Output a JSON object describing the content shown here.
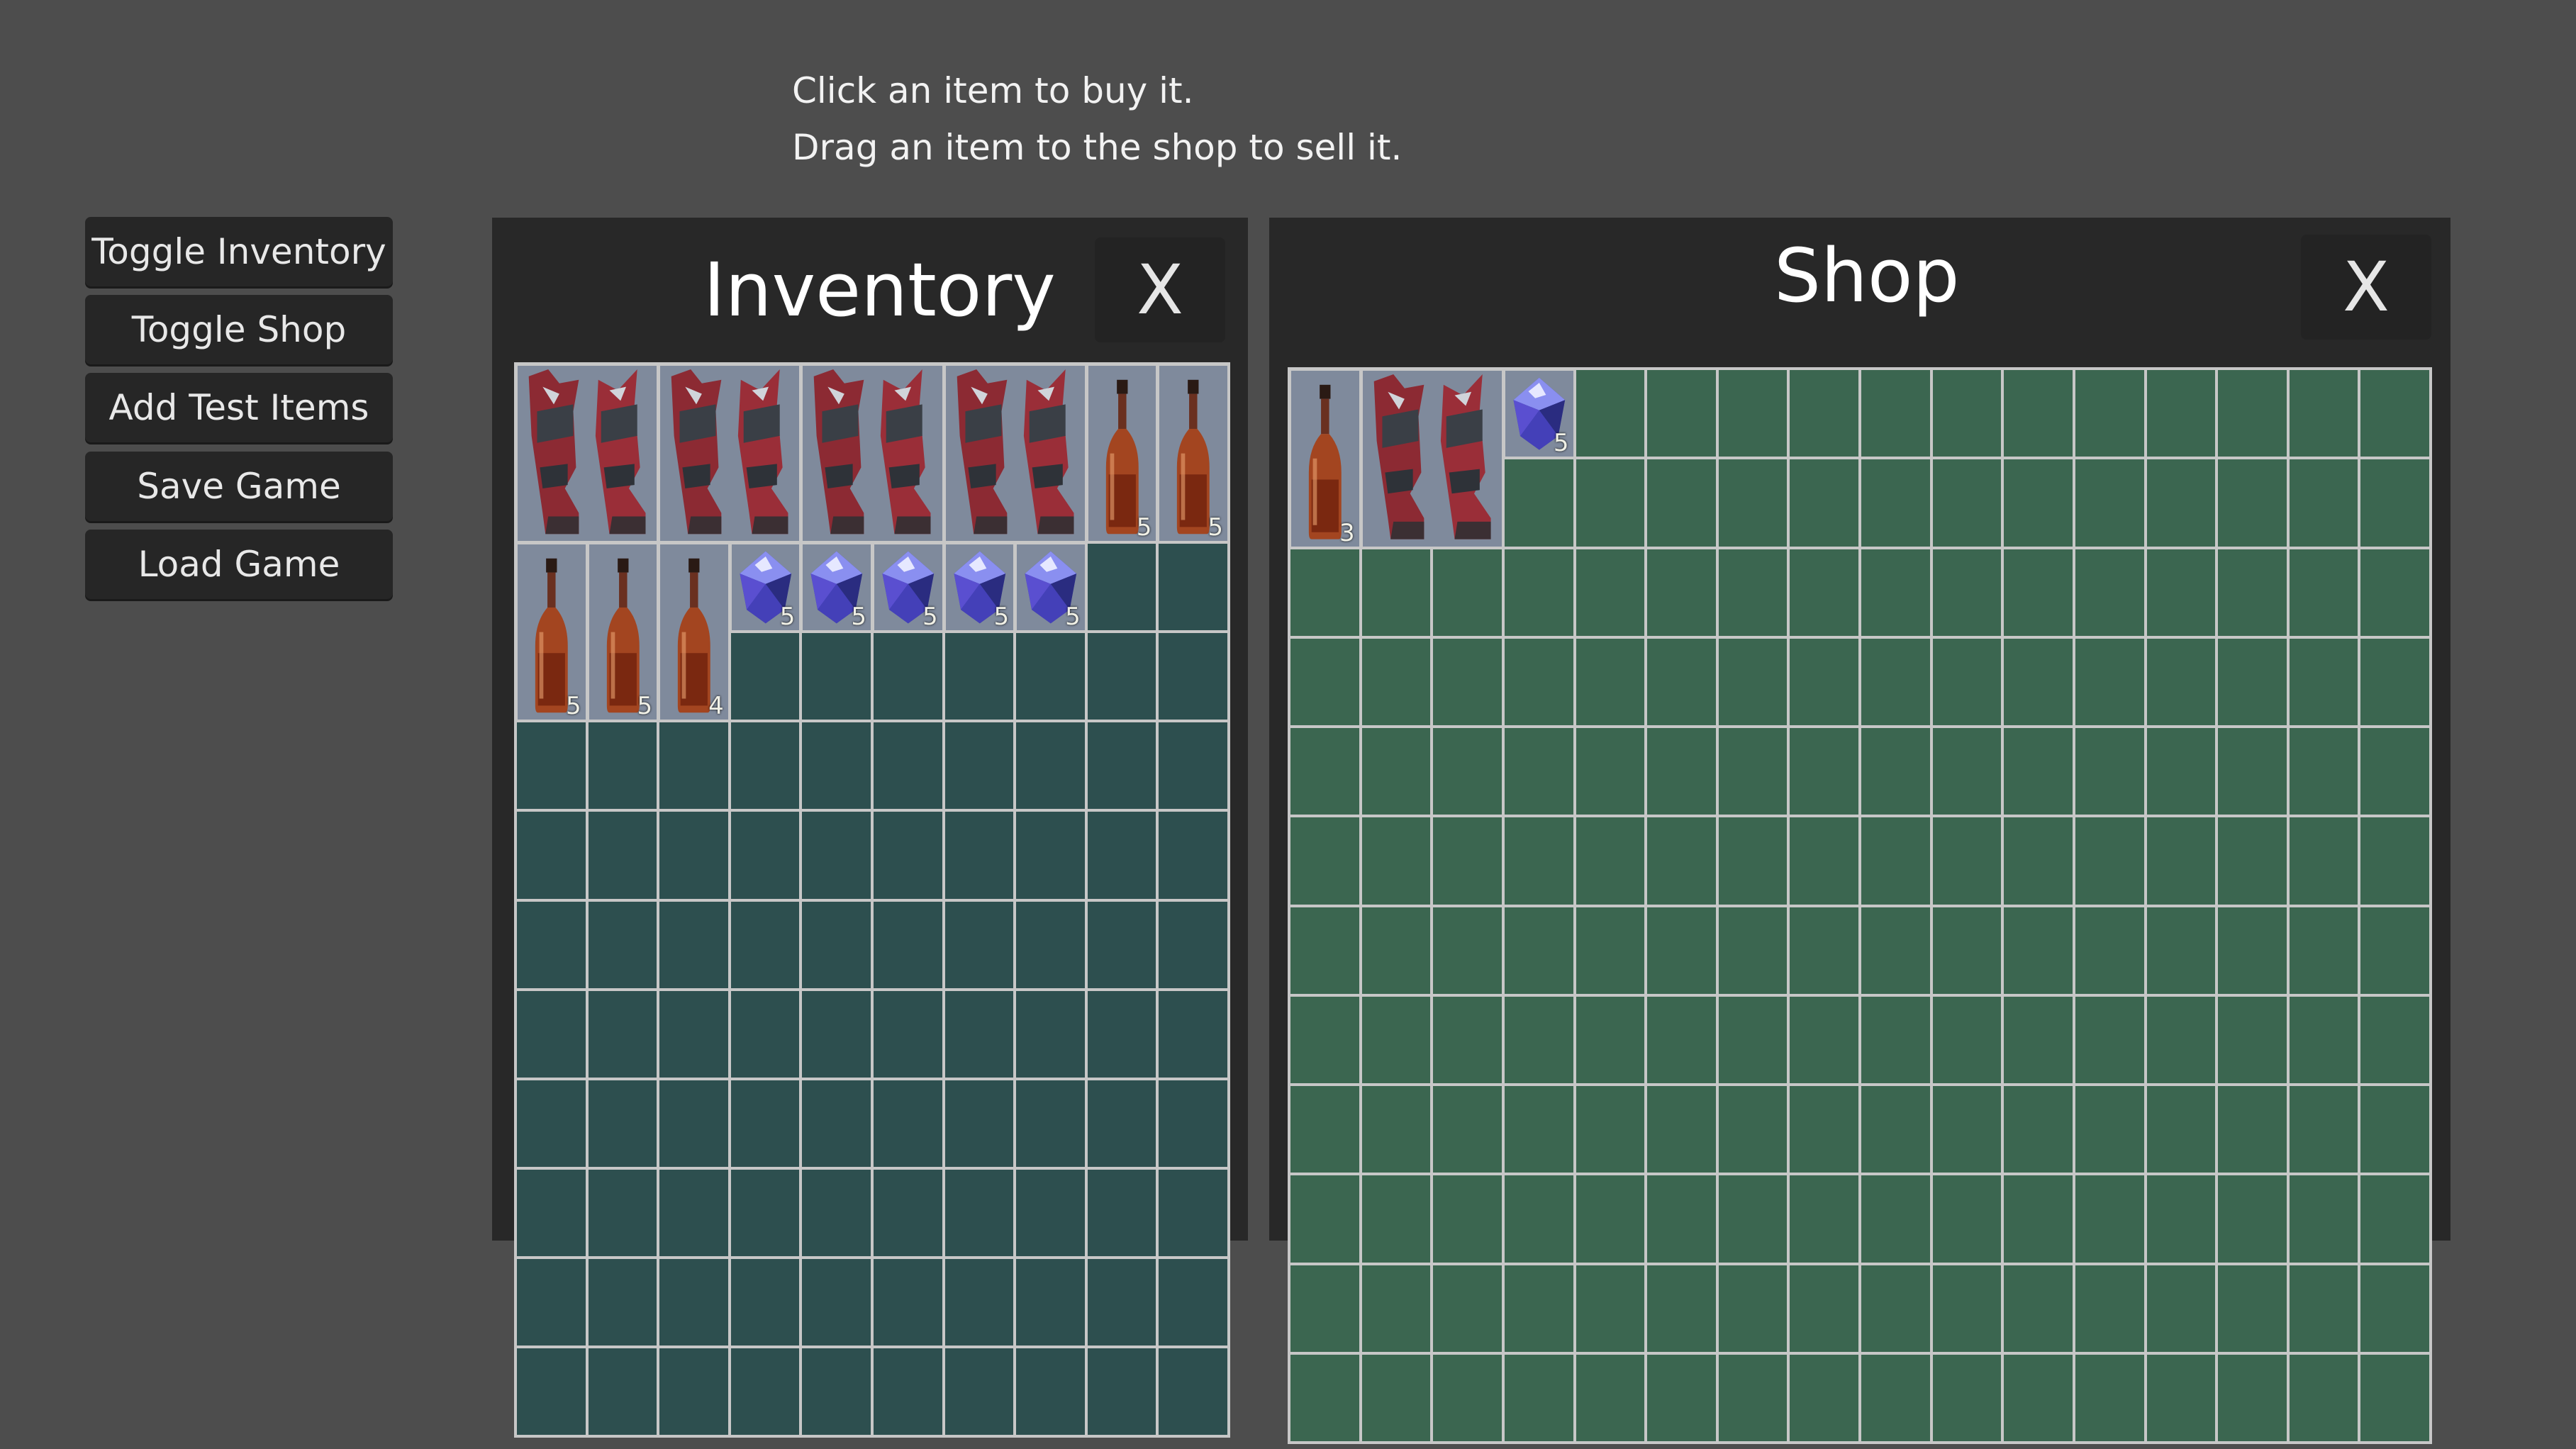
{
  "instructions": {
    "line1": "Click an item to buy it.",
    "line2": "Drag an item to the shop to sell it."
  },
  "sidebar": {
    "buttons": [
      {
        "label": "Toggle Inventory"
      },
      {
        "label": "Toggle Shop"
      },
      {
        "label": "Add Test Items"
      },
      {
        "label": "Save Game"
      },
      {
        "label": "Load Game"
      }
    ]
  },
  "inventory": {
    "title": "Inventory",
    "close_label": "X",
    "columns": 10,
    "rows": 12,
    "items": [
      {
        "type": "boots-icon",
        "col": 0,
        "row": 0,
        "w": 2,
        "h": 2,
        "qty": ""
      },
      {
        "type": "boots-icon",
        "col": 2,
        "row": 0,
        "w": 2,
        "h": 2,
        "qty": ""
      },
      {
        "type": "boots-icon",
        "col": 4,
        "row": 0,
        "w": 2,
        "h": 2,
        "qty": ""
      },
      {
        "type": "boots-icon",
        "col": 6,
        "row": 0,
        "w": 2,
        "h": 2,
        "qty": ""
      },
      {
        "type": "potion-icon",
        "col": 8,
        "row": 0,
        "w": 1,
        "h": 2,
        "qty": "5"
      },
      {
        "type": "potion-icon",
        "col": 9,
        "row": 0,
        "w": 1,
        "h": 2,
        "qty": "5"
      },
      {
        "type": "potion-icon",
        "col": 0,
        "row": 2,
        "w": 1,
        "h": 2,
        "qty": "5"
      },
      {
        "type": "potion-icon",
        "col": 1,
        "row": 2,
        "w": 1,
        "h": 2,
        "qty": "5"
      },
      {
        "type": "potion-icon",
        "col": 2,
        "row": 2,
        "w": 1,
        "h": 2,
        "qty": "4"
      },
      {
        "type": "gem-icon",
        "col": 3,
        "row": 2,
        "w": 1,
        "h": 1,
        "qty": "5"
      },
      {
        "type": "gem-icon",
        "col": 4,
        "row": 2,
        "w": 1,
        "h": 1,
        "qty": "5"
      },
      {
        "type": "gem-icon",
        "col": 5,
        "row": 2,
        "w": 1,
        "h": 1,
        "qty": "5"
      },
      {
        "type": "gem-icon",
        "col": 6,
        "row": 2,
        "w": 1,
        "h": 1,
        "qty": "5"
      },
      {
        "type": "gem-icon",
        "col": 7,
        "row": 2,
        "w": 1,
        "h": 1,
        "qty": "5"
      }
    ]
  },
  "shop": {
    "title": "Shop",
    "close_label": "X",
    "columns": 16,
    "rows": 12,
    "items": [
      {
        "type": "potion-icon",
        "col": 0,
        "row": 0,
        "w": 1,
        "h": 2,
        "qty": "3"
      },
      {
        "type": "boots-icon",
        "col": 1,
        "row": 0,
        "w": 2,
        "h": 2,
        "qty": ""
      },
      {
        "type": "gem-icon",
        "col": 3,
        "row": 0,
        "w": 1,
        "h": 1,
        "qty": "5"
      }
    ]
  },
  "colors": {
    "background": "#4d4d4d",
    "panel": "#282828",
    "inventory_cell": "#2d4f4f",
    "shop_cell": "#3b6650",
    "grid_line": "#c7c7c7",
    "occupied_cell": "#7f8a9c"
  }
}
